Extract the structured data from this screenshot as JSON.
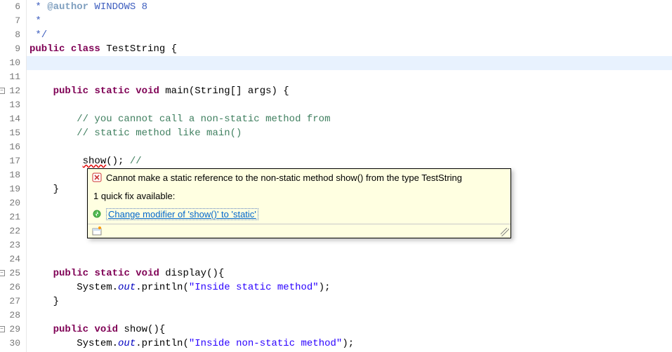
{
  "gutter": {
    "start": 6,
    "end": 30,
    "folds": [
      12,
      25,
      29
    ],
    "errors": [
      17
    ]
  },
  "code": {
    "6": {
      "indent": " ",
      "tokens": [
        {
          "c": "jdoc",
          "t": "*"
        },
        {
          "c": "",
          "t": " "
        },
        {
          "c": "jdoc-tag",
          "t": "@author"
        },
        {
          "c": "jdoc",
          "t": " WINDOWS 8"
        }
      ]
    },
    "7": {
      "indent": " ",
      "tokens": [
        {
          "c": "jdoc",
          "t": "*"
        }
      ]
    },
    "8": {
      "indent": " ",
      "tokens": [
        {
          "c": "jdoc",
          "t": "*/"
        }
      ]
    },
    "9": {
      "indent": "",
      "tokens": [
        {
          "c": "kw",
          "t": "public"
        },
        {
          "c": "",
          "t": " "
        },
        {
          "c": "kw",
          "t": "class"
        },
        {
          "c": "",
          "t": " TestString {"
        }
      ]
    },
    "10": {
      "indent": "    ",
      "hl": true,
      "tokens": []
    },
    "11": {
      "indent": "    ",
      "tokens": []
    },
    "12": {
      "indent": "    ",
      "tokens": [
        {
          "c": "kw",
          "t": "public"
        },
        {
          "c": "",
          "t": " "
        },
        {
          "c": "kw",
          "t": "static"
        },
        {
          "c": "",
          "t": " "
        },
        {
          "c": "kw",
          "t": "void"
        },
        {
          "c": "",
          "t": " main(String[] args) {"
        }
      ]
    },
    "13": {
      "indent": "        ",
      "tokens": []
    },
    "14": {
      "indent": "        ",
      "tokens": [
        {
          "c": "com",
          "t": "// you cannot call a non-static method from"
        }
      ]
    },
    "15": {
      "indent": "        ",
      "tokens": [
        {
          "c": "com",
          "t": "// static method like main()"
        }
      ]
    },
    "16": {
      "indent": "        ",
      "tokens": []
    },
    "17": {
      "indent": "         ",
      "tokens": [
        {
          "c": "err-underline",
          "t": "show"
        },
        {
          "c": "",
          "t": "(); "
        },
        {
          "c": "com",
          "t": "//"
        }
      ]
    },
    "18": {
      "indent": "        ",
      "tokens": []
    },
    "19": {
      "indent": "    ",
      "tokens": [
        {
          "c": "",
          "t": "}"
        }
      ]
    },
    "20": {
      "indent": "    ",
      "tokens": []
    },
    "21": {
      "indent": "    ",
      "tokens": []
    },
    "22": {
      "indent": "    ",
      "tokens": []
    },
    "23": {
      "indent": "    ",
      "tokens": []
    },
    "24": {
      "indent": "    ",
      "tokens": []
    },
    "25": {
      "indent": "    ",
      "tokens": [
        {
          "c": "kw",
          "t": "public"
        },
        {
          "c": "",
          "t": " "
        },
        {
          "c": "kw",
          "t": "static"
        },
        {
          "c": "",
          "t": " "
        },
        {
          "c": "kw",
          "t": "void"
        },
        {
          "c": "",
          "t": " display(){"
        }
      ]
    },
    "26": {
      "indent": "        ",
      "tokens": [
        {
          "c": "",
          "t": "System."
        },
        {
          "c": "field-static",
          "t": "out"
        },
        {
          "c": "",
          "t": ".println("
        },
        {
          "c": "str",
          "t": "\"Inside static method\""
        },
        {
          "c": "",
          "t": ");"
        }
      ]
    },
    "27": {
      "indent": "    ",
      "tokens": [
        {
          "c": "",
          "t": "}"
        }
      ]
    },
    "28": {
      "indent": "    ",
      "tokens": []
    },
    "29": {
      "indent": "    ",
      "tokens": [
        {
          "c": "kw",
          "t": "public"
        },
        {
          "c": "",
          "t": " "
        },
        {
          "c": "kw",
          "t": "void"
        },
        {
          "c": "",
          "t": " show(){"
        }
      ]
    },
    "30": {
      "indent": "        ",
      "tokens": [
        {
          "c": "",
          "t": "System."
        },
        {
          "c": "field-static",
          "t": "out"
        },
        {
          "c": "",
          "t": ".println("
        },
        {
          "c": "str",
          "t": "\"Inside non-static method\""
        },
        {
          "c": "",
          "t": ");"
        }
      ]
    }
  },
  "tooltip": {
    "error": "Cannot make a static reference to the non-static method show() from the type TestString",
    "fixHeader": "1 quick fix available:",
    "fix": "Change modifier of 'show()' to 'static'"
  }
}
